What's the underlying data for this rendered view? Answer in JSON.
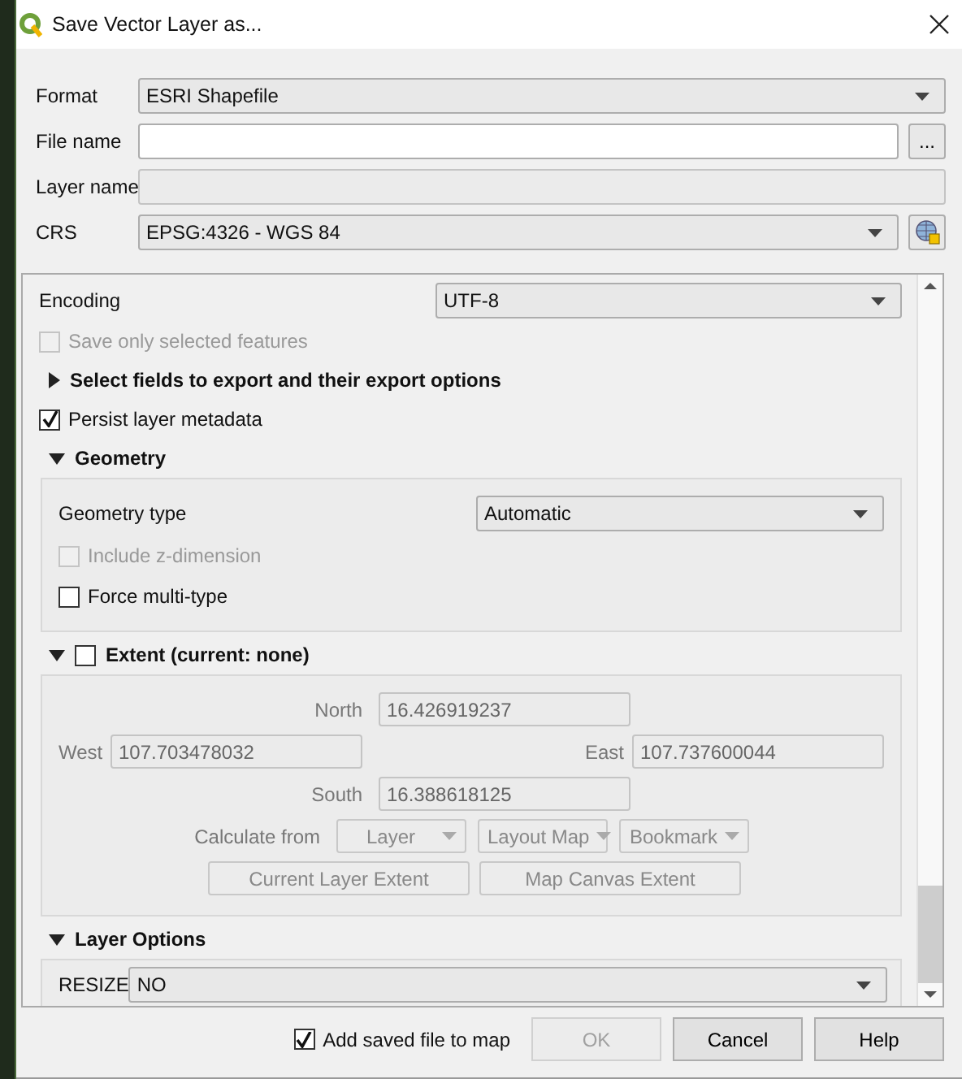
{
  "window": {
    "title": "Save Vector Layer as..."
  },
  "fields": [
    {
      "label": "Format",
      "kind": "combo",
      "value": "ESRI Shapefile"
    },
    {
      "label": "File name",
      "kind": "file",
      "button": "..."
    },
    {
      "label": "Layer name",
      "kind": "text",
      "disabled": true
    },
    {
      "label": "CRS",
      "kind": "crs",
      "value": "EPSG:4326 - WGS 84"
    }
  ],
  "options": {
    "encoding": {
      "label": "Encoding",
      "value": "UTF-8"
    },
    "save_selected": {
      "label": "Save only selected features",
      "checked": false,
      "disabled": true
    },
    "select_fields": {
      "label": "Select fields to export and their export options",
      "expanded": false
    },
    "persist_metadata": {
      "label": "Persist layer metadata",
      "checked": true,
      "disabled": false
    }
  },
  "geometry": {
    "title": "Geometry",
    "expanded": true,
    "type_label": "Geometry type",
    "type_value": "Automatic",
    "checks": [
      {
        "label": "Include z-dimension",
        "checked": false,
        "disabled": true
      },
      {
        "label": "Force multi-type",
        "checked": false,
        "disabled": false
      }
    ]
  },
  "extent": {
    "title": "Extent (current: none)",
    "expanded": true,
    "checked": false,
    "north": {
      "label": "North",
      "value": "16.426919237"
    },
    "west": {
      "label": "West",
      "value": "107.703478032"
    },
    "east": {
      "label": "East",
      "value": "107.737600044"
    },
    "south": {
      "label": "South",
      "value": "16.388618125"
    },
    "calculate_label": "Calculate from",
    "sources": [
      "Layer",
      "Layout Map",
      "Bookmark"
    ],
    "buttons": [
      "Current Layer Extent",
      "Map Canvas Extent"
    ]
  },
  "layer_options": {
    "title": "Layer Options",
    "expanded": true,
    "rows": [
      {
        "label": "RESIZE",
        "value": "NO"
      }
    ]
  },
  "footer": {
    "add_to_map": {
      "label": "Add saved file to map",
      "checked": true
    },
    "buttons": [
      {
        "label": "OK",
        "disabled": true
      },
      {
        "label": "Cancel",
        "disabled": false
      },
      {
        "label": "Help",
        "disabled": false
      }
    ]
  }
}
